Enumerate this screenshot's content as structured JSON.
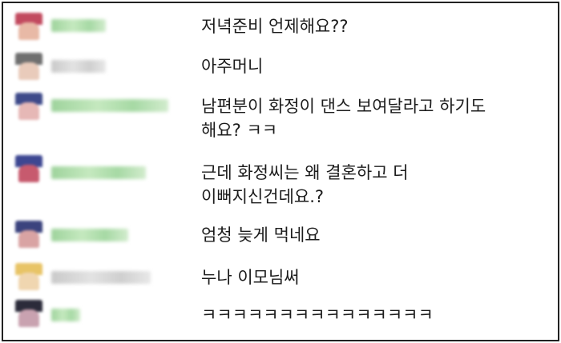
{
  "chat": {
    "messages": [
      {
        "text": "저녁준비 언제해요??",
        "name_color": "green",
        "avatar": "red-cap"
      },
      {
        "text": "아주머니",
        "name_color": "gray",
        "avatar": "gray-hair"
      },
      {
        "text": "남편분이 화정이 댄스 보여달라고 하기도\n해요? ㅋㅋ",
        "name_color": "green",
        "avatar": "navy-cap"
      },
      {
        "text": "근데 화정씨는 왜 결혼하고 더\n이뻐지신건데요.?",
        "name_color": "green",
        "avatar": "navy-red-cap"
      },
      {
        "text": "엄청 늦게 먹네요",
        "name_color": "green",
        "avatar": "navy-cap-2"
      },
      {
        "text": "누나 이모님써",
        "name_color": "gray",
        "avatar": "blonde"
      },
      {
        "text": "ㅋㅋㅋㅋㅋㅋㅋㅋㅋㅋㅋㅋㅋㅋㅋ",
        "name_color": "green",
        "avatar": "dark-hair"
      }
    ]
  }
}
